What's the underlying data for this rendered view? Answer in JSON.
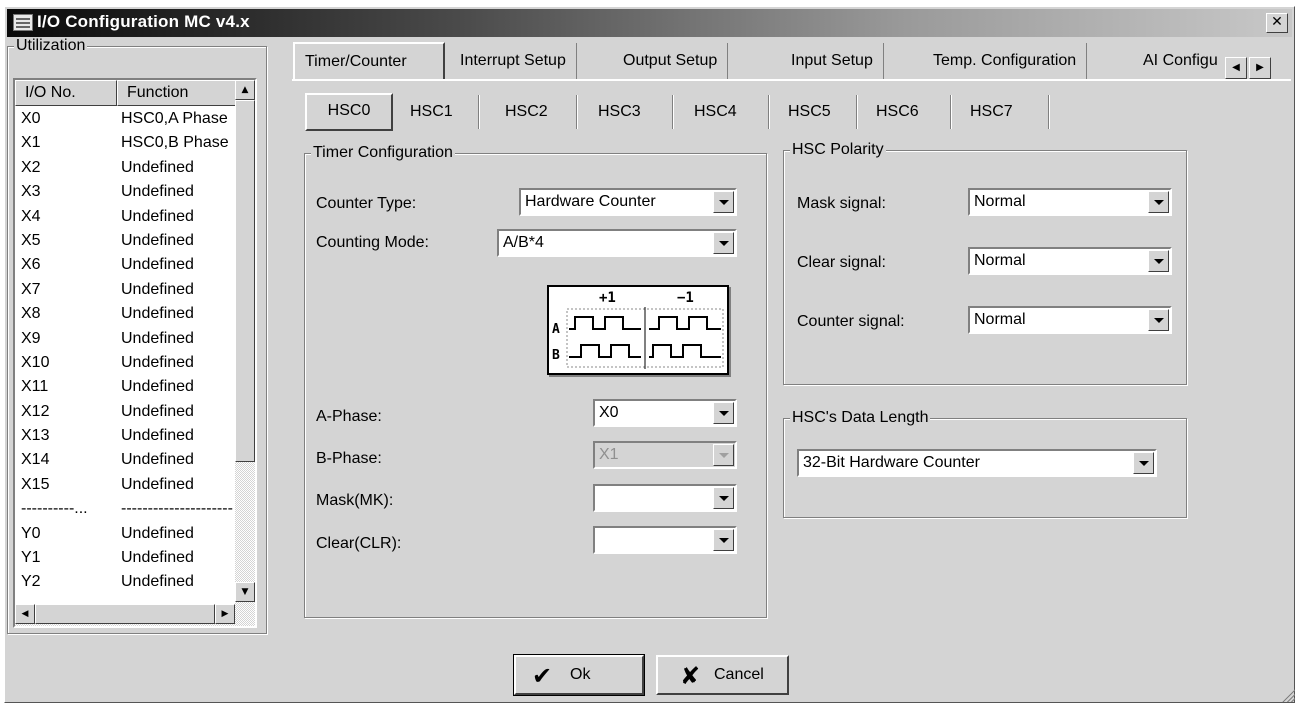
{
  "window": {
    "title": "I/O Configuration MC v4.x",
    "close_glyph": "✕"
  },
  "utilization": {
    "title": "Utilization",
    "headers": [
      "I/O No.",
      "Function"
    ],
    "rows": [
      [
        "X0",
        "HSC0,A Phase"
      ],
      [
        "X1",
        "HSC0,B Phase"
      ],
      [
        "X2",
        "Undefined"
      ],
      [
        "X3",
        "Undefined"
      ],
      [
        "X4",
        "Undefined"
      ],
      [
        "X5",
        "Undefined"
      ],
      [
        "X6",
        "Undefined"
      ],
      [
        "X7",
        "Undefined"
      ],
      [
        "X8",
        "Undefined"
      ],
      [
        "X9",
        "Undefined"
      ],
      [
        "X10",
        "Undefined"
      ],
      [
        "X11",
        "Undefined"
      ],
      [
        "X12",
        "Undefined"
      ],
      [
        "X13",
        "Undefined"
      ],
      [
        "X14",
        "Undefined"
      ],
      [
        "X15",
        "Undefined"
      ],
      [
        "----------...",
        "---------------------"
      ],
      [
        "Y0",
        "Undefined"
      ],
      [
        "Y1",
        "Undefined"
      ],
      [
        "Y2",
        "Undefined"
      ]
    ]
  },
  "tabs": [
    "Timer/Counter",
    "Interrupt Setup",
    "Output Setup",
    "Input Setup",
    "Temp. Configuration",
    "AI Configu"
  ],
  "active_tab": "Timer/Counter",
  "subtabs": [
    "HSC0",
    "HSC1",
    "HSC2",
    "HSC3",
    "HSC4",
    "HSC5",
    "HSC6",
    "HSC7"
  ],
  "active_subtab": "HSC0",
  "timer_config": {
    "title": "Timer Configuration",
    "counter_type_label": "Counter Type:",
    "counter_type_value": "Hardware Counter",
    "counting_mode_label": "Counting Mode:",
    "counting_mode_value": "A/B*4",
    "diagram": {
      "plus": "+1",
      "minus": "−1",
      "row_a": "A",
      "row_b": "B"
    },
    "a_phase_label": "A-Phase:",
    "a_phase_value": "X0",
    "b_phase_label": "B-Phase:",
    "b_phase_value": "X1",
    "mask_label": "Mask(MK):",
    "mask_value": "",
    "clear_label": "Clear(CLR):",
    "clear_value": ""
  },
  "hsc_polarity": {
    "title": "HSC Polarity",
    "mask_label": "Mask signal:",
    "mask_value": "Normal",
    "clear_label": "Clear signal:",
    "clear_value": "Normal",
    "counter_label": "Counter signal:",
    "counter_value": "Normal"
  },
  "data_length": {
    "title": "HSC's Data Length",
    "value": "32-Bit Hardware Counter"
  },
  "buttons": {
    "ok": "Ok",
    "ok_icon": "✔",
    "cancel": "Cancel",
    "cancel_icon": "✘"
  },
  "colors": {
    "face": "#d4d4d4",
    "shadow": "#808080",
    "highlight": "#ffffff",
    "title_dark": "#0a0a0a"
  }
}
